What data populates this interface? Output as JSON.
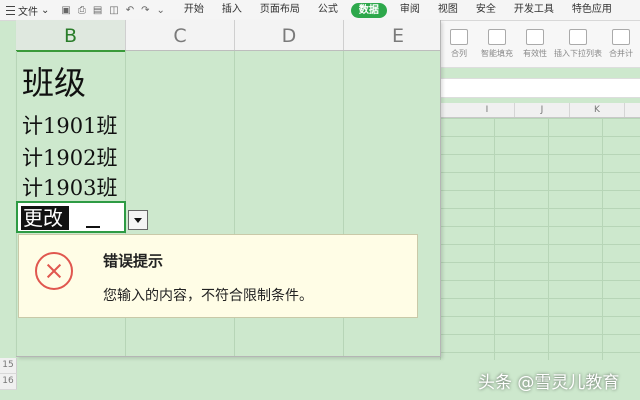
{
  "ribbon": {
    "file_label": "文件",
    "tabs": [
      "开始",
      "插入",
      "页面布局",
      "公式",
      "数据",
      "审阅",
      "视图",
      "安全",
      "开发工具",
      "特色应用"
    ],
    "active_tab": "数据"
  },
  "toolbar": {
    "tools": [
      "合列",
      "智能填充",
      "有效性",
      "插入下拉列表",
      "合并计"
    ]
  },
  "background_sheet": {
    "columns": [
      "I",
      "J",
      "K"
    ]
  },
  "sheet": {
    "columns": [
      "B",
      "C",
      "D",
      "E"
    ],
    "selected_column": "B",
    "cells": [
      "班级",
      "计1901班",
      "计1902班",
      "计1903班"
    ],
    "editing_value": "更改"
  },
  "error_dialog": {
    "title": "错误提示",
    "message": "您输入的内容，不符合限制条件。",
    "icon": "error-x-icon",
    "accent_color": "#e0574f"
  },
  "row_headers": [
    "15",
    "16"
  ],
  "watermark": "头条 @雪灵儿教育",
  "colors": {
    "sheet_background": "#cde8cd",
    "active_tab": "#2da84b",
    "selection_border": "#2e9b44"
  }
}
